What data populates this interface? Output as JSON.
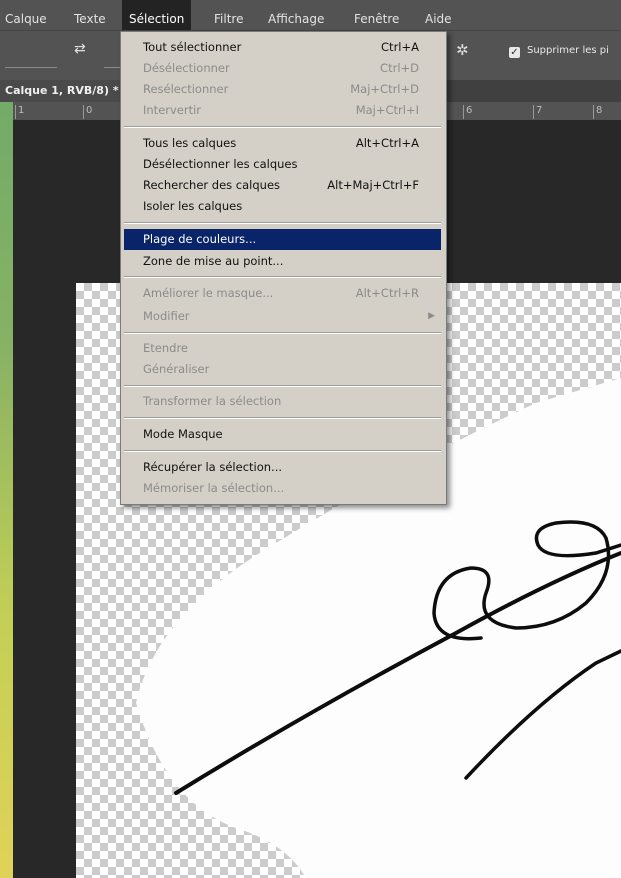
{
  "menubar": {
    "items": [
      "Calque",
      "Texte",
      "Sélection",
      "Filtre",
      "Affichage",
      "Fenêtre",
      "Aide"
    ],
    "active": "Sélection"
  },
  "options_bar": {
    "checkbox_label": "Supprimer les pi",
    "checkbox_checked": true
  },
  "document": {
    "tab_title": "Calque 1, RVB/8) *"
  },
  "ruler": {
    "ticks": [
      "1",
      "0",
      "6",
      "7",
      "8"
    ]
  },
  "menu": {
    "items": [
      {
        "label": "Tout sélectionner",
        "shortcut": "Ctrl+A",
        "enabled": true
      },
      {
        "label": "Désélectionner",
        "shortcut": "Ctrl+D",
        "enabled": false
      },
      {
        "label": "Resélectionner",
        "shortcut": "Maj+Ctrl+D",
        "enabled": false
      },
      {
        "label": "Intervertir",
        "shortcut": "Maj+Ctrl+I",
        "enabled": false
      },
      {
        "label": "Tous les calques",
        "shortcut": "Alt+Ctrl+A",
        "enabled": true
      },
      {
        "label": "Désélectionner les calques",
        "shortcut": "",
        "enabled": true
      },
      {
        "label": "Rechercher des calques",
        "shortcut": "Alt+Maj+Ctrl+F",
        "enabled": true
      },
      {
        "label": "Isoler les calques",
        "shortcut": "",
        "enabled": true
      },
      {
        "label": "Plage de couleurs...",
        "shortcut": "",
        "enabled": true,
        "highlighted": true
      },
      {
        "label": "Zone de mise au point...",
        "shortcut": "",
        "enabled": true
      },
      {
        "label": "Améliorer le masque...",
        "shortcut": "Alt+Ctrl+R",
        "enabled": false
      },
      {
        "label": "Modifier",
        "shortcut": "",
        "enabled": false,
        "submenu": true
      },
      {
        "label": "Etendre",
        "shortcut": "",
        "enabled": false
      },
      {
        "label": "Généraliser",
        "shortcut": "",
        "enabled": false
      },
      {
        "label": "Transformer la sélection",
        "shortcut": "",
        "enabled": false
      },
      {
        "label": "Mode Masque",
        "shortcut": "",
        "enabled": true
      },
      {
        "label": "Récupérer la sélection...",
        "shortcut": "",
        "enabled": true
      },
      {
        "label": "Mémoriser la sélection...",
        "shortcut": "",
        "enabled": false
      }
    ]
  },
  "colors": {
    "menu_background": "#d4d0c8",
    "menu_highlight": "#0a246a",
    "app_chrome": "#535353",
    "workspace": "#282828"
  },
  "icons": {
    "swap": "swap-arrows-icon",
    "gear": "gear-icon",
    "submenu": "chevron-right-icon",
    "checkbox": "checkbox-checked-icon"
  }
}
